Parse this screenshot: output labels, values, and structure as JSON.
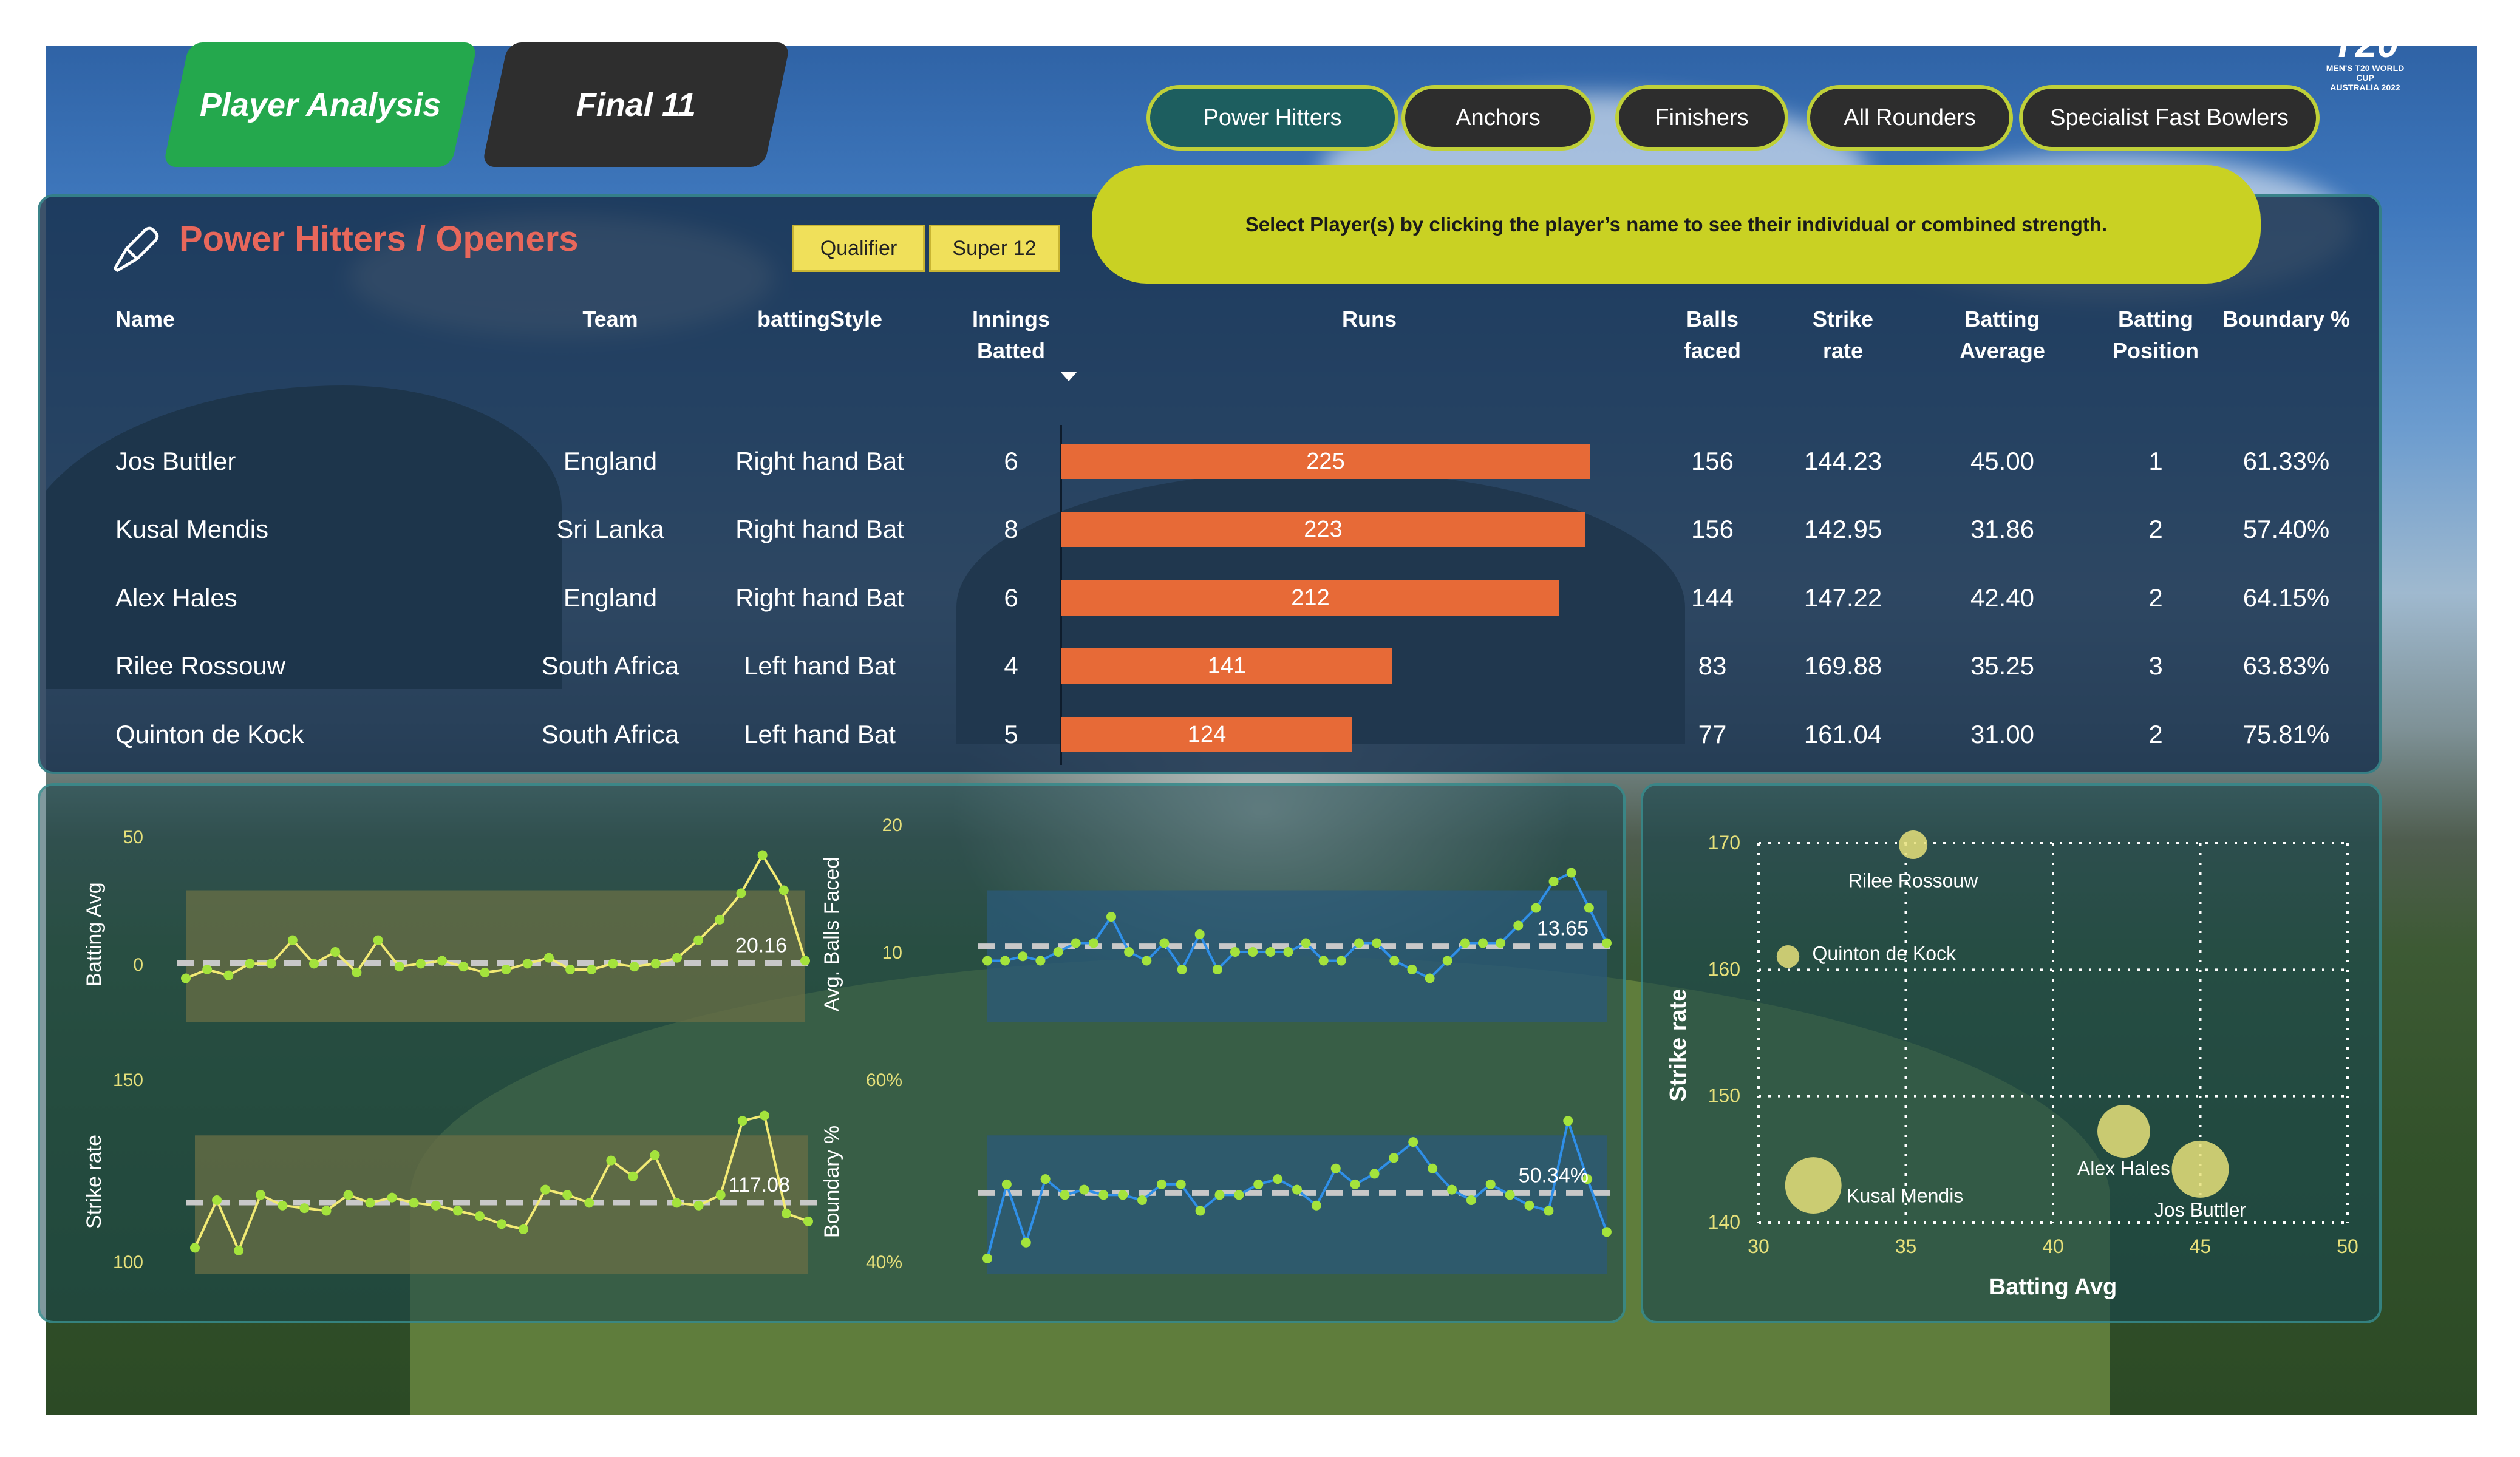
{
  "tabs": [
    {
      "label": "Player Analysis",
      "active": true
    },
    {
      "label": "Final 11",
      "active": false
    }
  ],
  "categories": [
    {
      "label": "Power Hitters",
      "active": true
    },
    {
      "label": "Anchors",
      "active": false
    },
    {
      "label": "Finishers",
      "active": false
    },
    {
      "label": "All Rounders",
      "active": false
    },
    {
      "label": "Specialist Fast Bowlers",
      "active": false
    }
  ],
  "logo": {
    "big": "T20",
    "small": "MEN'S T20 WORLD CUP",
    "sub": "AUSTRALIA 2022"
  },
  "notice": "Select Player(s) by clicking the player’s name to see their individual or combined strength.",
  "section_title": "Power Hitters / Openers",
  "stage_filters": [
    "Qualifier",
    "Super 12"
  ],
  "table": {
    "headers": {
      "name": "Name",
      "team": "Team",
      "style": "battingStyle",
      "innings": [
        "Innings",
        "Batted"
      ],
      "runs": "Runs",
      "balls": [
        "Balls",
        "faced"
      ],
      "sr": [
        "Strike",
        "rate"
      ],
      "avg": [
        "Batting",
        "Average"
      ],
      "pos": [
        "Batting",
        "Position"
      ],
      "boundary": "Boundary %"
    },
    "rows": [
      {
        "name": "Jos Buttler",
        "team": "England",
        "style": "Right hand Bat",
        "innings": "6",
        "runs": 225,
        "balls": "156",
        "sr": "144.23",
        "avg": "45.00",
        "pos": "1",
        "boundary": "61.33%"
      },
      {
        "name": "Kusal Mendis",
        "team": "Sri Lanka",
        "style": "Right hand Bat",
        "innings": "8",
        "runs": 223,
        "balls": "156",
        "sr": "142.95",
        "avg": "31.86",
        "pos": "2",
        "boundary": "57.40%"
      },
      {
        "name": "Alex Hales",
        "team": "England",
        "style": "Right hand Bat",
        "innings": "6",
        "runs": 212,
        "balls": "144",
        "sr": "147.22",
        "avg": "42.40",
        "pos": "2",
        "boundary": "64.15%"
      },
      {
        "name": "Rilee Rossouw",
        "team": "South Africa",
        "style": "Left hand Bat",
        "innings": "4",
        "runs": 141,
        "balls": "83",
        "sr": "169.88",
        "avg": "35.25",
        "pos": "3",
        "boundary": "63.83%"
      },
      {
        "name": "Quinton de Kock",
        "team": "South Africa",
        "style": "Left hand Bat",
        "innings": "5",
        "runs": 124,
        "balls": "77",
        "sr": "161.04",
        "avg": "31.00",
        "pos": "2",
        "boundary": "75.81%"
      }
    ]
  },
  "chart_data": [
    {
      "type": "area",
      "ylabel": "Batting Avg",
      "yticks": [
        "50",
        "0"
      ],
      "ylim": [
        0,
        60
      ],
      "reference_label": "20.16",
      "reference_value": 20.16,
      "colors": {
        "line": "#f2ea74",
        "marker": "#a4e33c",
        "fill": "#6a6f45"
      },
      "values": [
        15,
        18,
        16,
        20,
        20,
        28,
        20,
        24,
        17,
        28,
        19,
        20,
        21,
        19,
        17,
        18,
        20,
        22,
        18,
        18,
        20,
        19,
        20,
        22,
        28,
        35,
        44,
        57,
        45,
        21
      ]
    },
    {
      "type": "area",
      "ylabel": "Avg. Balls Faced",
      "yticks": [
        "20",
        "10"
      ],
      "ylim": [
        5,
        25
      ],
      "reference_label": "13.65",
      "reference_value": 13.65,
      "colors": {
        "line": "#2f8fe8",
        "marker": "#a4e33c",
        "fill": "#2b5a7a"
      },
      "values": [
        12,
        12,
        12.5,
        12,
        13,
        14,
        14,
        17,
        13,
        12,
        14,
        11,
        15,
        11,
        13,
        13,
        13,
        13,
        14,
        12,
        12,
        14,
        14,
        12,
        11,
        10,
        12,
        14,
        14,
        14,
        16,
        18,
        21,
        22,
        18,
        14
      ]
    },
    {
      "type": "area",
      "ylabel": "Strike rate",
      "yticks": [
        "150",
        "100"
      ],
      "ylim": [
        90,
        160
      ],
      "reference_label": "117.08",
      "reference_value": 117.08,
      "colors": {
        "line": "#f2ea74",
        "marker": "#a4e33c",
        "fill": "#6a6f45"
      },
      "values": [
        100,
        118,
        99,
        120,
        116,
        115,
        114,
        120,
        117,
        119,
        117,
        116,
        114,
        112,
        109,
        107,
        122,
        120,
        117,
        133,
        127,
        135,
        117,
        116,
        120,
        148,
        150,
        113,
        110
      ]
    },
    {
      "type": "area",
      "ylabel": "Boundary %",
      "yticks": [
        "60%",
        "40%"
      ],
      "ylim": [
        35,
        70
      ],
      "reference_label": "50.34%",
      "reference_value": 50.34,
      "colors": {
        "line": "#2f8fe8",
        "marker": "#a4e33c",
        "fill": "#2b5a7a"
      },
      "values": [
        38,
        52,
        41,
        53,
        50,
        51,
        50,
        50,
        49,
        52,
        52,
        47,
        50,
        50,
        52,
        53,
        51,
        48,
        55,
        52,
        54,
        57,
        60,
        55,
        51,
        49,
        52,
        50,
        48,
        47,
        64,
        53,
        43
      ]
    },
    {
      "type": "scatter",
      "xlabel": "Batting Avg",
      "ylabel": "Strike rate",
      "xlim": [
        30,
        50
      ],
      "ylim": [
        140,
        170
      ],
      "xticks": [
        "30",
        "35",
        "40",
        "45",
        "50"
      ],
      "yticks": [
        "170",
        "160",
        "150",
        "140"
      ],
      "colors": {
        "point": "#e6e07a",
        "grid": "#ffffff"
      },
      "points": [
        {
          "label": "Rilee Rossouw",
          "x": 35.25,
          "y": 169.88,
          "size": 141
        },
        {
          "label": "Quinton de Kock",
          "x": 31.0,
          "y": 161.04,
          "size": 124
        },
        {
          "label": "Alex Hales",
          "x": 42.4,
          "y": 147.22,
          "size": 212
        },
        {
          "label": "Jos Buttler",
          "x": 45.0,
          "y": 144.23,
          "size": 225
        },
        {
          "label": "Kusal Mendis",
          "x": 31.86,
          "y": 142.95,
          "size": 223
        }
      ]
    }
  ]
}
